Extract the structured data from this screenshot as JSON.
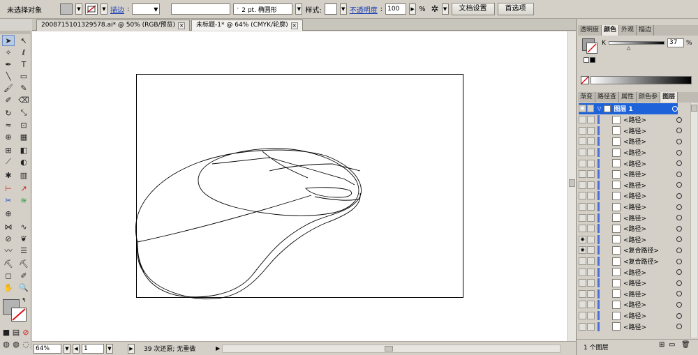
{
  "control_bar": {
    "selection_label": "未选择对象",
    "stroke_label": "描边",
    "stroke_weight_placeholder": "",
    "brush_label": "2 pt. 椭圆形",
    "style_label": "样式:",
    "opacity_label": "不透明度",
    "opacity_value": "100",
    "opacity_unit": "%",
    "doc_setup_button": "文档设置",
    "prefs_button": "首选项"
  },
  "tabs": [
    {
      "label": "200871510132957​8.ai* @ 50% (RGB/预览)"
    },
    {
      "label": "未标题-1* @ 64% (CMYK/轮廓)"
    }
  ],
  "status_bar": {
    "zoom": "64%",
    "page": "1",
    "history": "39 次还原; 无重做"
  },
  "panels": {
    "top_tabs": [
      "透明度",
      "颜色",
      "外观",
      "描边"
    ],
    "color_channel": "K",
    "color_value": "37",
    "color_unit": "%",
    "bottom_tabs": [
      "渐变",
      "路径查",
      "属性",
      "颜色参",
      "图层"
    ],
    "layer_name": "图层 1",
    "layers": [
      "<路径>",
      "<路径>",
      "<路径>",
      "<路径>",
      "<路径>",
      "<路径>",
      "<路径>",
      "<路径>",
      "<路径>",
      "<路径>",
      "<路径>",
      "<路径>",
      "<复合路径>",
      "<复合路径>",
      "<路径>",
      "<路径>",
      "<路径>",
      "<路径>",
      "<路径>",
      "<路径>"
    ],
    "layer_count": "1 个图层"
  },
  "colors": {
    "selection_blue": "#1e62d9",
    "layer_bar": "#4b6fd8"
  }
}
